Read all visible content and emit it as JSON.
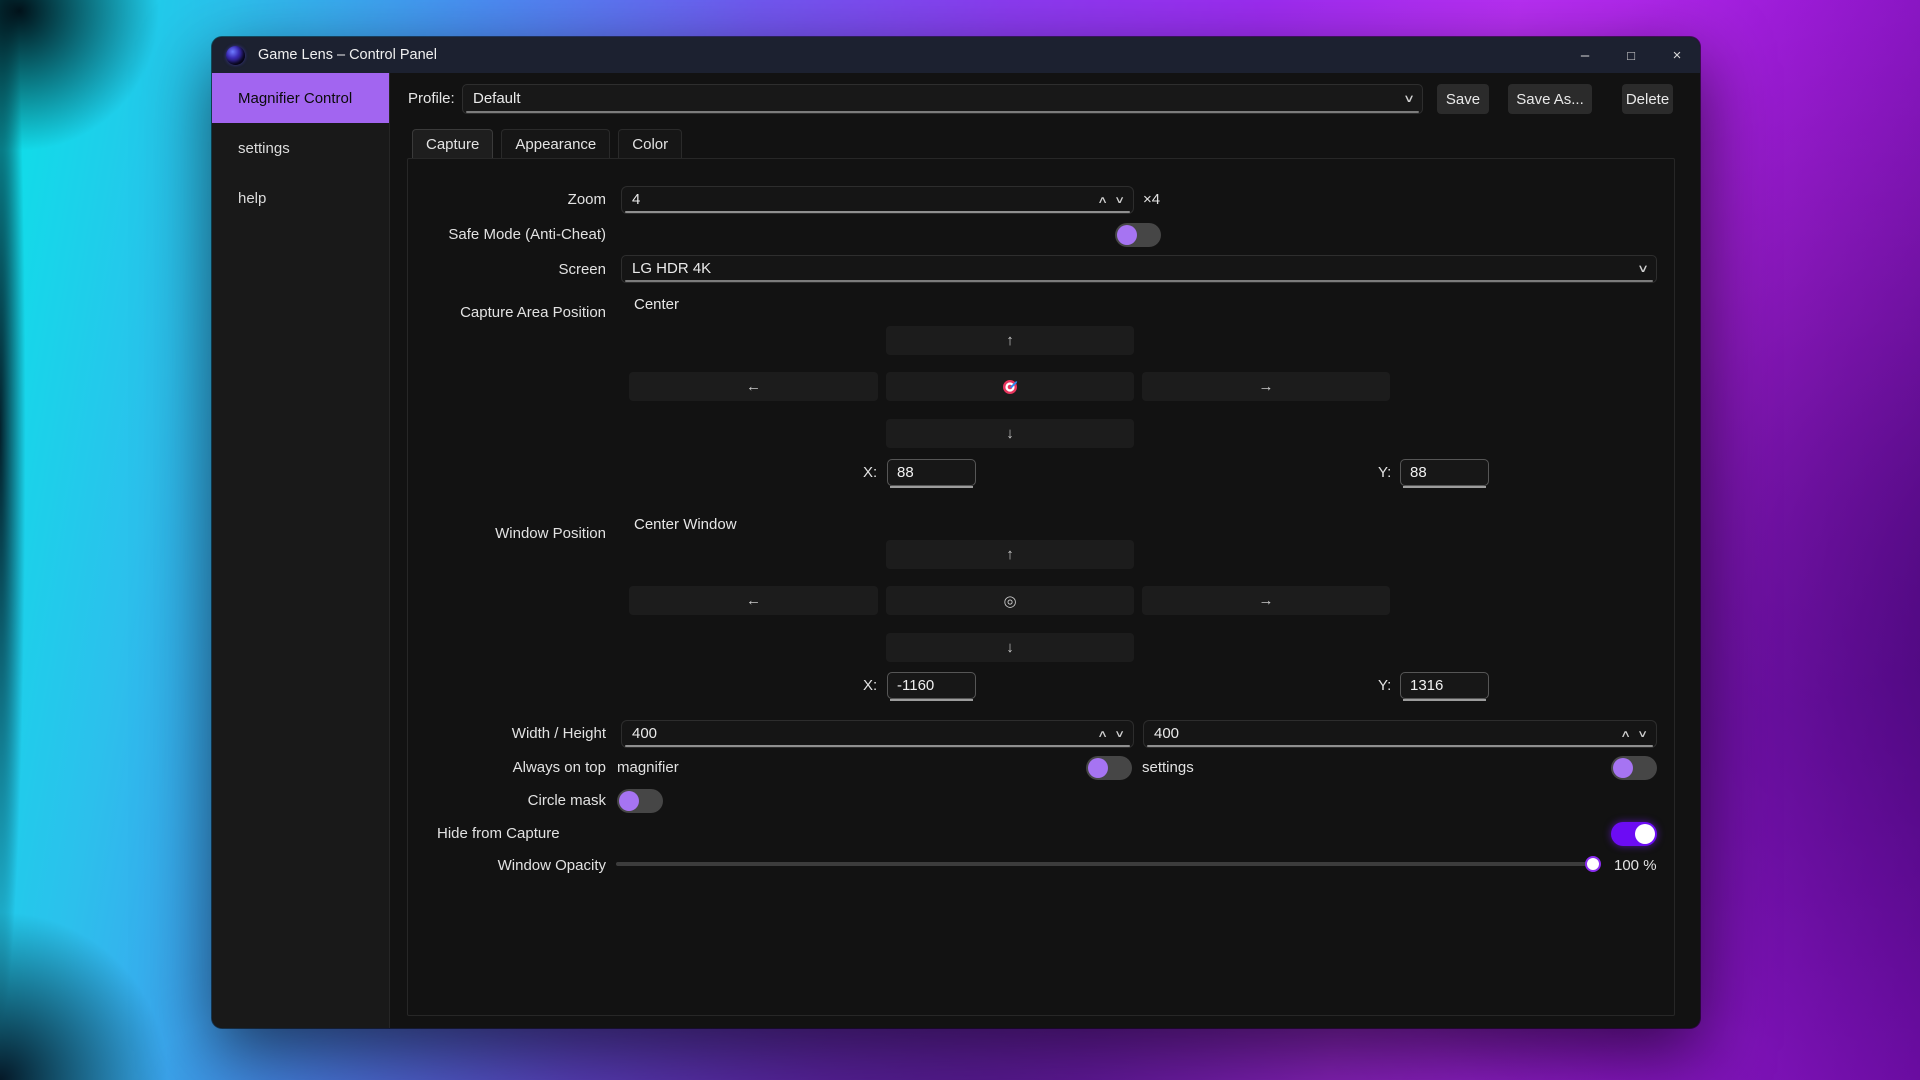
{
  "window": {
    "title": "Game Lens – Control Panel",
    "minimize_glyph": "–",
    "maximize_glyph": "□",
    "close_glyph": "×"
  },
  "sidebar": {
    "items": [
      {
        "label": "Magnifier Control",
        "active": true
      },
      {
        "label": "settings",
        "active": false
      },
      {
        "label": "help",
        "active": false
      }
    ]
  },
  "profile_bar": {
    "label": "Profile:",
    "value": "Default",
    "save": "Save",
    "save_as": "Save As...",
    "delete": "Delete"
  },
  "tabs": [
    {
      "label": "Capture",
      "active": true
    },
    {
      "label": "Appearance",
      "active": false
    },
    {
      "label": "Color",
      "active": false
    }
  ],
  "capture": {
    "zoom": {
      "label": "Zoom",
      "value": "4",
      "multiplier": "×4"
    },
    "safe_mode": {
      "label": "Safe Mode (Anti-Cheat)",
      "enabled": false
    },
    "screen": {
      "label": "Screen",
      "value": "LG HDR 4K"
    },
    "pad_glyphs": {
      "up": "↑",
      "down": "↓",
      "left": "←",
      "right": "→"
    },
    "capture_area": {
      "label": "Capture Area Position",
      "center_button": "Center",
      "x_label": "X:",
      "x_value": "88",
      "y_label": "Y:",
      "y_value": "88"
    },
    "window_position": {
      "label": "Window Position",
      "center_button": "Center Window",
      "center_glyph": "◎",
      "x_label": "X:",
      "x_value": "-1160",
      "y_label": "Y:",
      "y_value": "1316"
    },
    "size": {
      "label": "Width / Height",
      "width_value": "400",
      "height_value": "400"
    },
    "always_on_top": {
      "label": "Always on top",
      "magnifier": "magnifier",
      "settings": "settings",
      "magnifier_enabled": false,
      "settings_enabled": false
    },
    "circle_mask": {
      "label": "Circle mask",
      "enabled": false
    },
    "hide_from_capture": {
      "label": "Hide from Capture",
      "enabled": true
    },
    "window_opacity": {
      "label": "Window Opacity",
      "value": "100 %",
      "percent": 100
    }
  },
  "icons": {
    "spin_up": "∧",
    "spin_down": "∨",
    "chevron_down": "∨"
  },
  "colors": {
    "accent_purple": "#a265f0",
    "toggle_on_purple": "#6c0cf4",
    "toggle_knob_off": "#a674f2",
    "titlebar": "#1c2130"
  }
}
